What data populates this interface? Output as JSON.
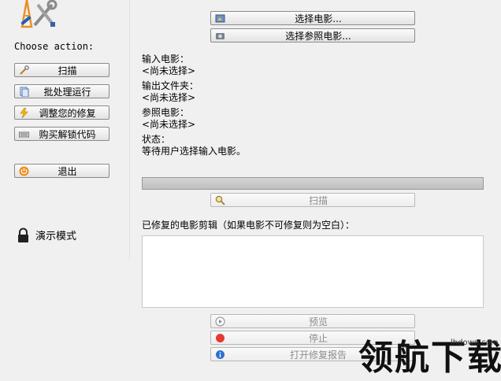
{
  "sidebar": {
    "choose_action": "Choose action:",
    "buttons": {
      "scan": "扫描",
      "batch": "批处理运行",
      "adjust": "调整您的修复",
      "buy": "购买解锁代码",
      "exit": "退出"
    },
    "demo_mode": "演示模式"
  },
  "main": {
    "select_movie_button": "选择电影...",
    "select_reference_button": "选择参照电影...",
    "input_movie_label": "输入电影：",
    "input_movie_value": "<尚未选择>",
    "output_folder_label": "输出文件夹：",
    "output_folder_value": "<尚未选择>",
    "reference_movie_label": "参照电影：",
    "reference_movie_value": "<尚未选择>",
    "status_label": "状态：",
    "status_value": "等待用户选择输入电影。",
    "progress": 0,
    "scan_button": "扫描",
    "repaired_label": "已修复的电影剪辑（如果电影不可修复则为空白）：",
    "preview_button": "预览",
    "stop_button": "停止",
    "open_report_button": "打开修复报告"
  },
  "watermark": {
    "text": "领航下载",
    "url": "lhdown.com"
  },
  "colors": {
    "accent": "#e8902a",
    "stop": "#e53935",
    "info": "#2f6fd1",
    "exit": "#f08a1c"
  }
}
